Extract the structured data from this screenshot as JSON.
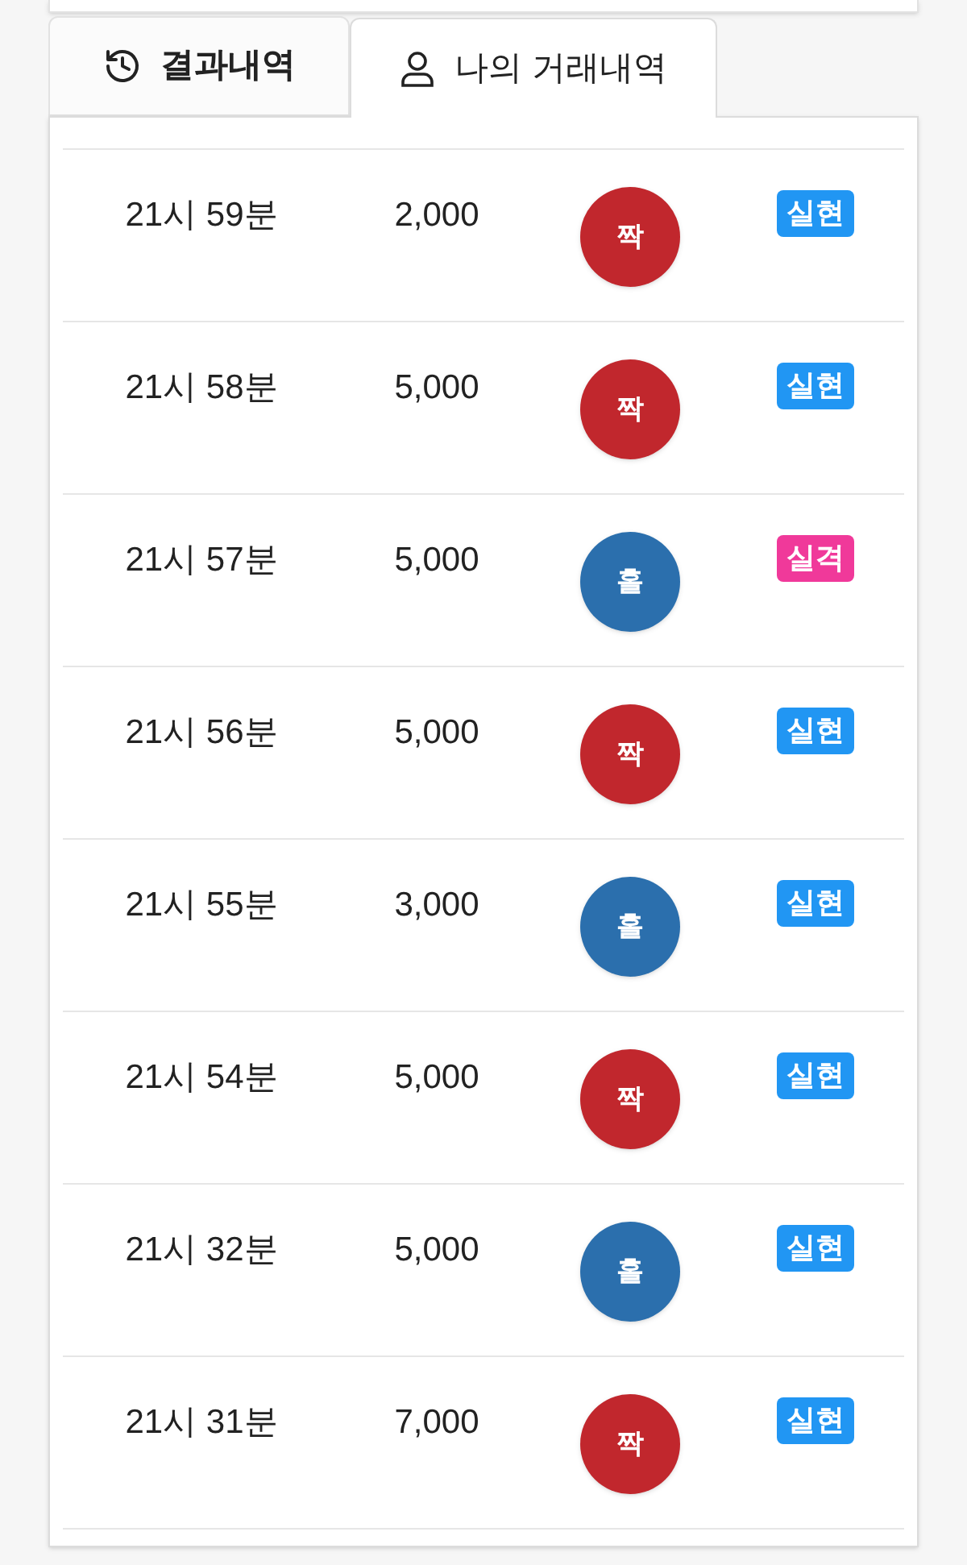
{
  "tabs": [
    {
      "label": "결과내역",
      "kind": "history",
      "selected": false
    },
    {
      "label": "나의 거래내역",
      "kind": "user",
      "selected": true
    }
  ],
  "rows": [
    {
      "time": "21시 59분",
      "amount": "2,000",
      "pick": {
        "label": "짝",
        "kind": "even"
      },
      "status": {
        "label": "실현",
        "kind": "win"
      }
    },
    {
      "time": "21시 58분",
      "amount": "5,000",
      "pick": {
        "label": "짝",
        "kind": "even"
      },
      "status": {
        "label": "실현",
        "kind": "win"
      }
    },
    {
      "time": "21시 57분",
      "amount": "5,000",
      "pick": {
        "label": "홀",
        "kind": "odd"
      },
      "status": {
        "label": "실격",
        "kind": "lose"
      }
    },
    {
      "time": "21시 56분",
      "amount": "5,000",
      "pick": {
        "label": "짝",
        "kind": "even"
      },
      "status": {
        "label": "실현",
        "kind": "win"
      }
    },
    {
      "time": "21시 55분",
      "amount": "3,000",
      "pick": {
        "label": "홀",
        "kind": "odd"
      },
      "status": {
        "label": "실현",
        "kind": "win"
      }
    },
    {
      "time": "21시 54분",
      "amount": "5,000",
      "pick": {
        "label": "짝",
        "kind": "even"
      },
      "status": {
        "label": "실현",
        "kind": "win"
      }
    },
    {
      "time": "21시 32분",
      "amount": "5,000",
      "pick": {
        "label": "홀",
        "kind": "odd"
      },
      "status": {
        "label": "실현",
        "kind": "win"
      }
    },
    {
      "time": "21시 31분",
      "amount": "7,000",
      "pick": {
        "label": "짝",
        "kind": "even"
      },
      "status": {
        "label": "실현",
        "kind": "win"
      }
    }
  ]
}
